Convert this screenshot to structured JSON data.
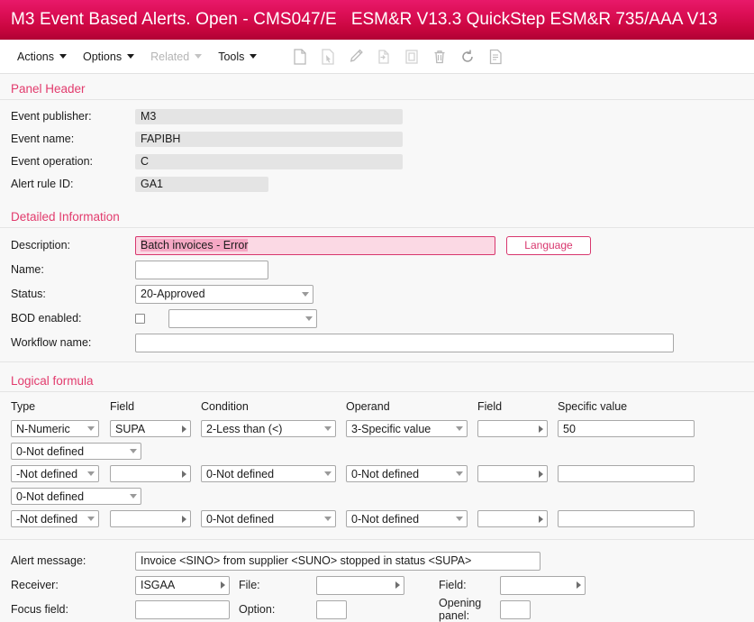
{
  "titlebar": {
    "title": "M3 Event Based Alerts. Open - CMS047/E",
    "subtitle": "ESM&R V13.3 QuickStep ESM&R 735/AAA V13"
  },
  "toolbar": {
    "menus": [
      {
        "label": "Actions",
        "disabled": false
      },
      {
        "label": "Options",
        "disabled": false
      },
      {
        "label": "Related",
        "disabled": true
      },
      {
        "label": "Tools",
        "disabled": false
      }
    ],
    "icons": [
      "new-document-icon",
      "select-document-icon",
      "edit-pencil-icon",
      "copy-to-icon",
      "duplicate-icon",
      "delete-trash-icon",
      "refresh-icon",
      "details-document-icon"
    ]
  },
  "panel_header": {
    "title": "Panel Header",
    "fields": [
      {
        "label": "Event publisher:",
        "value": "M3"
      },
      {
        "label": "Event name:",
        "value": "FAPIBH"
      },
      {
        "label": "Event operation:",
        "value": "C"
      },
      {
        "label": "Alert rule ID:",
        "value": "GA1"
      }
    ]
  },
  "detailed_information": {
    "title": "Detailed Information",
    "description_label": "Description:",
    "description_value": "Batch invoices - Error",
    "language_button": "Language",
    "name_label": "Name:",
    "name_value": "",
    "status_label": "Status:",
    "status_value": "20-Approved",
    "bod_label": "BOD enabled:",
    "bod_checked": false,
    "bod_select_value": "",
    "workflow_label": "Workflow name:",
    "workflow_value": ""
  },
  "logical_formula": {
    "title": "Logical formula",
    "headers": {
      "type": "Type",
      "field": "Field",
      "condition": "Condition",
      "operand": "Operand",
      "field2": "Field",
      "specific_value": "Specific value"
    },
    "rows": [
      {
        "type": "N-Numeric",
        "field": "SUPA",
        "condition": "2-Less than (<)",
        "operand": "3-Specific value",
        "field2": "",
        "specific_value": "50"
      },
      {
        "type": "-Not defined",
        "field": "",
        "condition": "0-Not defined",
        "operand": "0-Not defined",
        "field2": "",
        "specific_value": ""
      },
      {
        "type": "-Not defined",
        "field": "",
        "condition": "0-Not defined",
        "operand": "0-Not defined",
        "field2": "",
        "specific_value": ""
      }
    ],
    "connectors": [
      "0-Not defined",
      "0-Not defined"
    ]
  },
  "bottom": {
    "alert_message_label": "Alert message:",
    "alert_message_value": "Invoice <SINO> from supplier <SUNO> stopped in status <SUPA>",
    "receiver_label": "Receiver:",
    "receiver_value": "ISGAA",
    "file_label": "File:",
    "file_value": "",
    "field_label": "Field:",
    "field_value": "",
    "focus_field_label": "Focus field:",
    "focus_field_value": "",
    "option_label": "Option:",
    "option_value": "",
    "opening_panel_label": "Opening panel:",
    "opening_panel_value": ""
  },
  "colors": {
    "brand_pink": "#d8376e",
    "title_bar_top": "#e8196a",
    "title_bar_bottom": "#b00134",
    "error_field_bg": "#fbd9e4",
    "readonly_bg": "#e4e4e4",
    "page_bg": "#f8f8f8"
  }
}
